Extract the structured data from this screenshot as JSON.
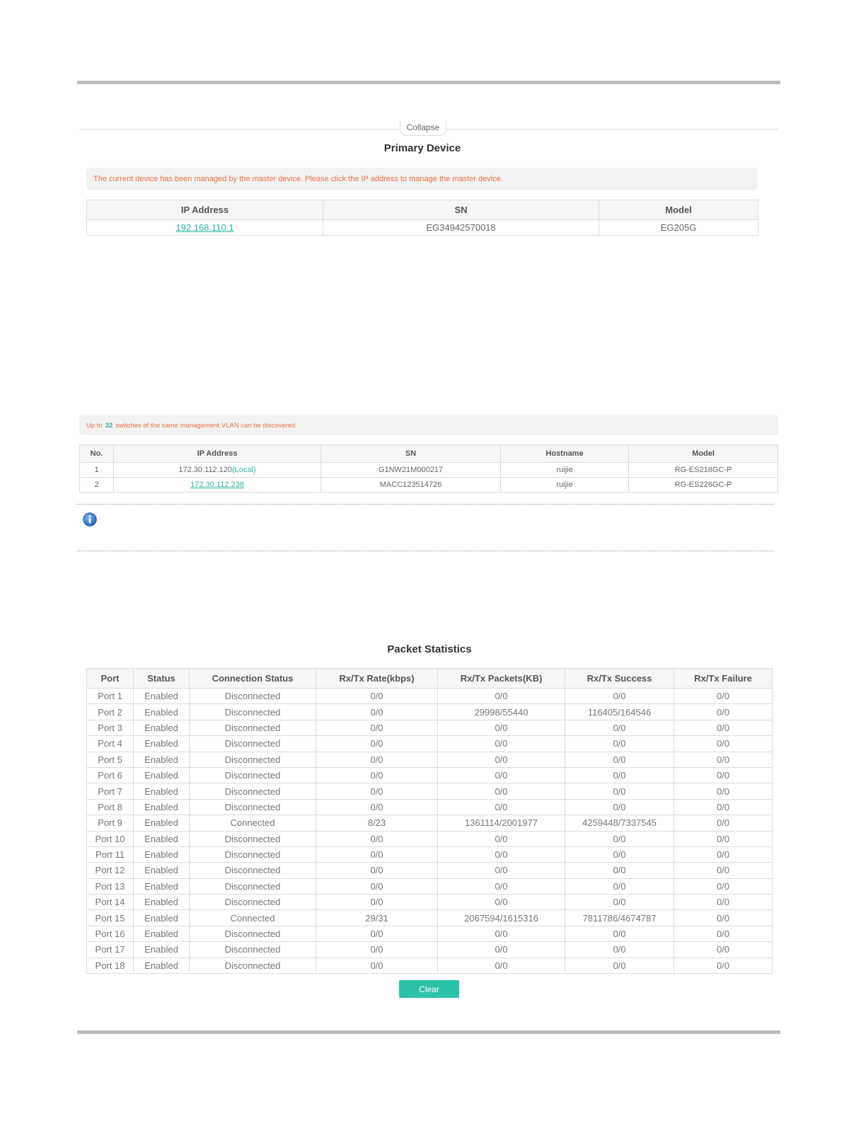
{
  "collapse_label": "Collapse",
  "primary": {
    "title": "Primary Device",
    "notice": "The current device has been managed by the master device. Please click the IP address to manage the master device.",
    "headers": [
      "IP Address",
      "SN",
      "Model"
    ],
    "row": {
      "ip": "192.168.110.1",
      "sn": "EG34942570018",
      "model": "EG205G"
    }
  },
  "switches": {
    "notice_prefix": "Up to",
    "notice_count": "32",
    "notice_suffix": "switches of the same management VLAN can be discovered.",
    "headers": [
      "No.",
      "IP Address",
      "SN",
      "Hostname",
      "Model"
    ],
    "local_tag": "(Local)",
    "rows": [
      {
        "no": "1",
        "ip": "172.30.112.120",
        "sn": "G1NW21M000217",
        "hostname": "ruijie",
        "model": "RG-ES218GC-P"
      },
      {
        "no": "2",
        "ip": "172.30.112.238",
        "sn": "MACC123514726",
        "hostname": "ruijie",
        "model": "RG-ES226GC-P"
      }
    ]
  },
  "stats": {
    "title": "Packet Statistics",
    "headers": [
      "Port",
      "Status",
      "Connection Status",
      "Rx/Tx Rate(kbps)",
      "Rx/Tx Packets(KB)",
      "Rx/Tx Success",
      "Rx/Tx Failure"
    ],
    "rows": [
      [
        "Port 1",
        "Enabled",
        "Disconnected",
        "0/0",
        "0/0",
        "0/0",
        "0/0"
      ],
      [
        "Port 2",
        "Enabled",
        "Disconnected",
        "0/0",
        "29998/55440",
        "116405/164546",
        "0/0"
      ],
      [
        "Port 3",
        "Enabled",
        "Disconnected",
        "0/0",
        "0/0",
        "0/0",
        "0/0"
      ],
      [
        "Port 4",
        "Enabled",
        "Disconnected",
        "0/0",
        "0/0",
        "0/0",
        "0/0"
      ],
      [
        "Port 5",
        "Enabled",
        "Disconnected",
        "0/0",
        "0/0",
        "0/0",
        "0/0"
      ],
      [
        "Port 6",
        "Enabled",
        "Disconnected",
        "0/0",
        "0/0",
        "0/0",
        "0/0"
      ],
      [
        "Port 7",
        "Enabled",
        "Disconnected",
        "0/0",
        "0/0",
        "0/0",
        "0/0"
      ],
      [
        "Port 8",
        "Enabled",
        "Disconnected",
        "0/0",
        "0/0",
        "0/0",
        "0/0"
      ],
      [
        "Port 9",
        "Enabled",
        "Connected",
        "8/23",
        "1361114/2001977",
        "4259448/7337545",
        "0/0"
      ],
      [
        "Port 10",
        "Enabled",
        "Disconnected",
        "0/0",
        "0/0",
        "0/0",
        "0/0"
      ],
      [
        "Port 11",
        "Enabled",
        "Disconnected",
        "0/0",
        "0/0",
        "0/0",
        "0/0"
      ],
      [
        "Port 12",
        "Enabled",
        "Disconnected",
        "0/0",
        "0/0",
        "0/0",
        "0/0"
      ],
      [
        "Port 13",
        "Enabled",
        "Disconnected",
        "0/0",
        "0/0",
        "0/0",
        "0/0"
      ],
      [
        "Port 14",
        "Enabled",
        "Disconnected",
        "0/0",
        "0/0",
        "0/0",
        "0/0"
      ],
      [
        "Port 15",
        "Enabled",
        "Connected",
        "29/31",
        "2067594/1615316",
        "7811786/4674787",
        "0/0"
      ],
      [
        "Port 16",
        "Enabled",
        "Disconnected",
        "0/0",
        "0/0",
        "0/0",
        "0/0"
      ],
      [
        "Port 17",
        "Enabled",
        "Disconnected",
        "0/0",
        "0/0",
        "0/0",
        "0/0"
      ],
      [
        "Port 18",
        "Enabled",
        "Disconnected",
        "0/0",
        "0/0",
        "0/0",
        "0/0"
      ]
    ],
    "clear_label": "Clear"
  },
  "icons": {
    "info": "info-icon"
  },
  "colors": {
    "accent": "#2cb5a0",
    "notice": "#e8734a",
    "button": "#2cc2a8"
  }
}
